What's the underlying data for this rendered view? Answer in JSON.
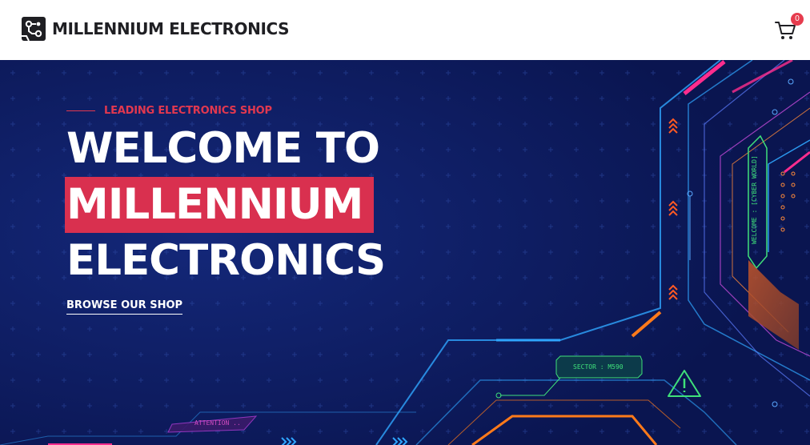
{
  "header": {
    "brand_name": "MILLENNIUM ELECTRONICS",
    "logo_icon": "circuit-logo-icon",
    "cart_icon": "shopping-cart-icon",
    "cart_count": "0"
  },
  "hero": {
    "eyebrow": "LEADING ELECTRONICS SHOP",
    "headline_line1": "WELCOME TO",
    "headline_line2": "MILLENNIUM",
    "headline_line3": "ELECTRONICS",
    "cta_label": "BROWSE OUR SHOP",
    "decor_labels": {
      "sector": "SECTOR : M590",
      "attention": "ATTENTION ..",
      "welcome": "WELCOME : [CYBER WORLD]"
    }
  },
  "colors": {
    "accent": "#d9304f",
    "hero_background": "#0b1a5c",
    "header_background": "#ffffff",
    "brand_text": "#1f1f23"
  }
}
